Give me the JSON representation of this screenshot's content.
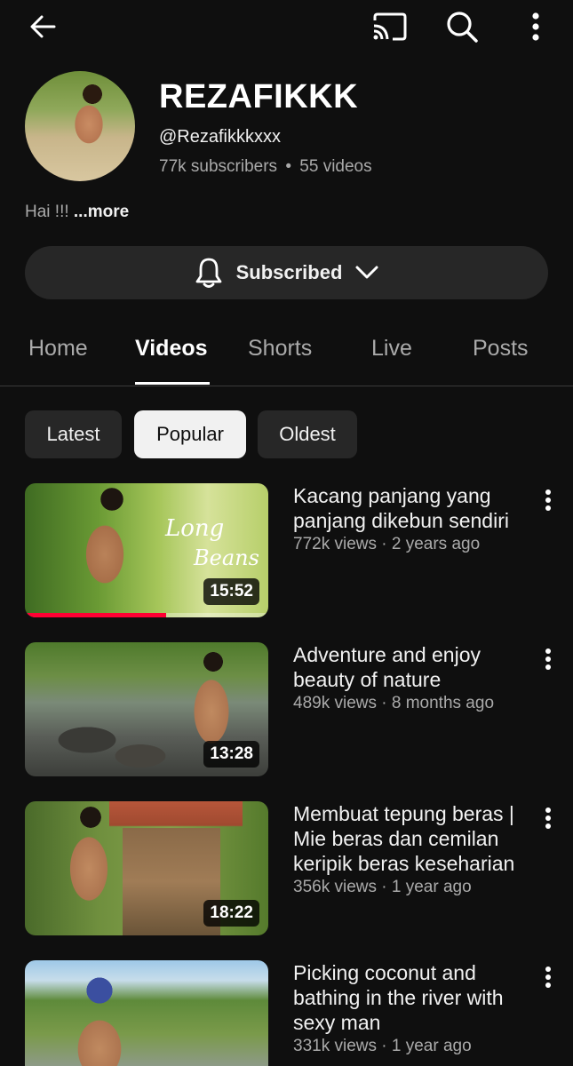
{
  "header": {
    "back_icon": "arrow-left-icon",
    "cast_icon": "cast-icon",
    "search_icon": "search-icon",
    "more_icon": "more-vertical-icon"
  },
  "channel": {
    "name": "REZAFIKKK",
    "handle": "@Rezafikkkxxx",
    "subscribers": "77k subscribers",
    "separator": "•",
    "video_count": "55 videos",
    "description": "Hai !!!",
    "more_label": "...more"
  },
  "subscribe": {
    "label": "Subscribed",
    "bell_icon": "bell-icon",
    "chevron_icon": "chevron-down-icon"
  },
  "tabs": [
    {
      "label": "Home",
      "active": false
    },
    {
      "label": "Videos",
      "active": true
    },
    {
      "label": "Shorts",
      "active": false
    },
    {
      "label": "Live",
      "active": false
    },
    {
      "label": "Posts",
      "active": false
    }
  ],
  "filters": [
    {
      "label": "Latest",
      "active": false
    },
    {
      "label": "Popular",
      "active": true
    },
    {
      "label": "Oldest",
      "active": false
    }
  ],
  "videos": [
    {
      "title": "Kacang panjang yang panjang dikebun sendiri",
      "meta": "772k views · 2 years ago",
      "duration": "15:52",
      "watched_fraction": 0.58,
      "thumb_text_1": "Long",
      "thumb_text_2": "Beans"
    },
    {
      "title": "Adventure and enjoy beauty of nature",
      "meta": "489k views · 8 months ago",
      "duration": "13:28"
    },
    {
      "title": "Membuat tepung beras | Mie beras dan cemilan keripik beras keseharian",
      "meta": "356k views · 1 year ago",
      "duration": "18:22"
    },
    {
      "title": "Picking coconut and bathing in the river with sexy man",
      "meta": "331k views · 1 year ago",
      "duration": ""
    }
  ],
  "colors": {
    "background": "#0f0f0f",
    "progress": "#ff0033",
    "chip_active": "#f1f1f1",
    "chip": "#272727"
  }
}
